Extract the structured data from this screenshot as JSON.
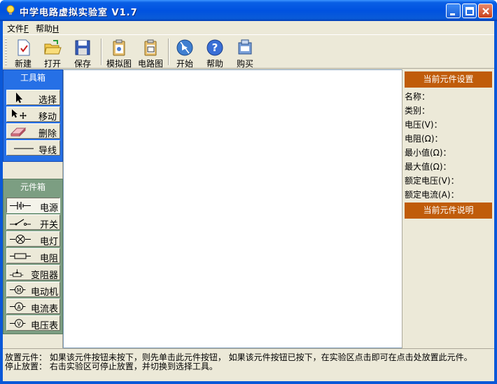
{
  "window": {
    "title": "中学电路虚拟实验室  V1.7"
  },
  "menu": [
    {
      "label": "文件",
      "accel": "F"
    },
    {
      "label": "帮助",
      "accel": "H"
    }
  ],
  "toolbar": {
    "new": "新建",
    "open": "打开",
    "save": "保存",
    "sim_view": "模拟图",
    "circuit_view": "电路图",
    "start": "开始",
    "help": "帮助",
    "buy": "购买"
  },
  "toolbox": {
    "title": "工具箱",
    "items": [
      "选择",
      "移动",
      "删除",
      "导线"
    ]
  },
  "parts": {
    "title": "元件箱",
    "items": [
      "电源",
      "开关",
      "电灯",
      "电阻",
      "变阻器",
      "电动机",
      "电流表",
      "电压表"
    ]
  },
  "settings": {
    "title": "当前元件设置",
    "fields": [
      "名称：",
      "类别：",
      "电压(V)：",
      "电阻(Ω)：",
      "最小值(Ω)：",
      "最大值(Ω)：",
      "额定电压(V)：",
      "额定电流(A)："
    ],
    "description_title": "当前元件说明"
  },
  "status": {
    "line1": "放置元件：  如果该元件按钮未按下，则先单击此元件按钮， 如果该元件按钮已按下，在实验区点击即可在点击处放置此元件。",
    "line2": "停止放置：  右击实验区可停止放置，并切换到选择工具。"
  },
  "colors": {
    "titlebar": "#0052e0",
    "toolbox_bg": "#2670e6",
    "parts_bg": "#7c9e82",
    "settings_header": "#c05c0a"
  }
}
